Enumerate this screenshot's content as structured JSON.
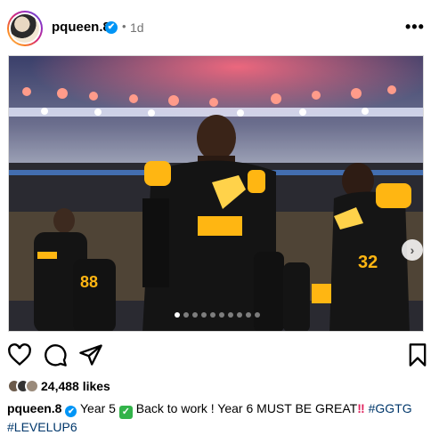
{
  "post": {
    "username": "pqueen.8",
    "verified_mark": "✔",
    "separator": "•",
    "time_ago": "1d",
    "more_label": "•••",
    "media": {
      "alt_icon": "photo",
      "next_label": "›",
      "slides_count": 10,
      "active_slide": 1
    },
    "likes": "24,488 likes",
    "caption": {
      "username": "pqueen.8",
      "part1": "Year 5",
      "check": "✓",
      "part2": "Back to work ! Year 6 MUST BE GREAT",
      "bang": "‼",
      "hashtag1": "#GGTG",
      "hashtag2": "#LEVELUP6"
    }
  },
  "colors": {
    "verified": "#0095f6",
    "hashtag": "#00376b",
    "steelers_gold": "#ffb612"
  }
}
